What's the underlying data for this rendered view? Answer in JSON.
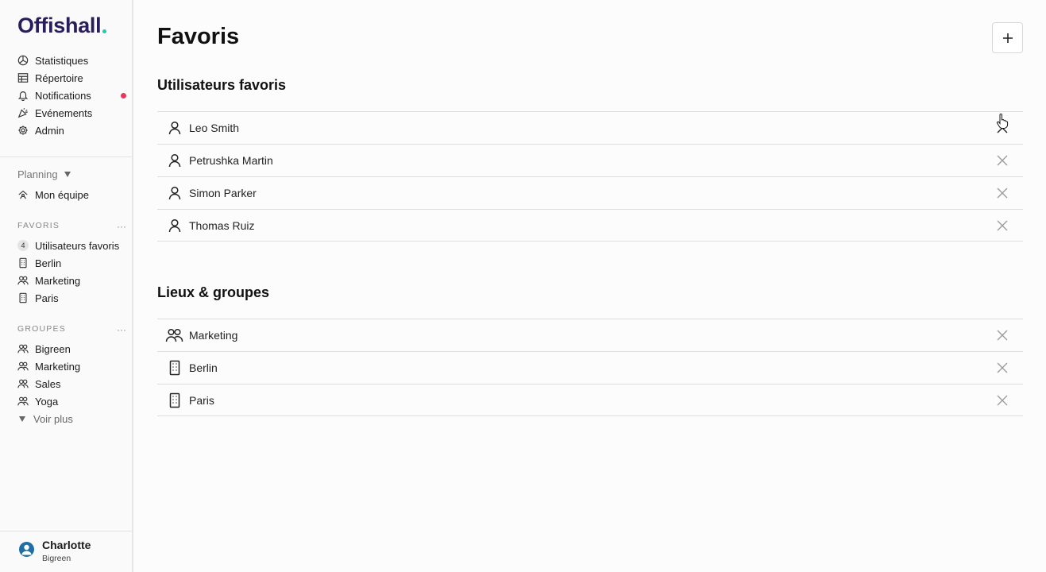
{
  "app": {
    "logo_text": "Offishall",
    "brand_color": "#2a1d5c",
    "accent_color": "#1ec8b4"
  },
  "sidebar": {
    "nav": [
      {
        "label": "Statistiques",
        "icon": "chart-icon"
      },
      {
        "label": "Répertoire",
        "icon": "table-icon"
      },
      {
        "label": "Notifications",
        "icon": "bell-icon",
        "has_unread": true
      },
      {
        "label": "Evénements",
        "icon": "party-icon"
      },
      {
        "label": "Admin",
        "icon": "gear-icon"
      }
    ],
    "planning_label": "Planning",
    "team_label": "Mon équipe",
    "favorites": {
      "header": "FAVORIS",
      "items": [
        {
          "label": "Utilisateurs favoris",
          "badge": "4"
        },
        {
          "label": "Berlin",
          "icon": "building-icon"
        },
        {
          "label": "Marketing",
          "icon": "group-icon"
        },
        {
          "label": "Paris",
          "icon": "building-icon"
        }
      ]
    },
    "groups": {
      "header": "GROUPES",
      "items": [
        {
          "label": "Bigreen"
        },
        {
          "label": "Marketing"
        },
        {
          "label": "Sales"
        },
        {
          "label": "Yoga"
        }
      ],
      "more_label": "Voir plus"
    },
    "more_glyph": "···",
    "user": {
      "name": "Charlotte",
      "org": "Bigreen"
    }
  },
  "main": {
    "title": "Favoris",
    "users_section": {
      "title": "Utilisateurs favoris",
      "rows": [
        "Leo Smith",
        "Petrushka Martin",
        "Simon Parker",
        "Thomas Ruiz"
      ]
    },
    "places_section": {
      "title": "Lieux & groupes",
      "rows": [
        {
          "label": "Marketing",
          "icon": "group-icon"
        },
        {
          "label": "Berlin",
          "icon": "building-icon"
        },
        {
          "label": "Paris",
          "icon": "building-icon"
        }
      ]
    },
    "notification_dot_color": "#e8385a"
  }
}
